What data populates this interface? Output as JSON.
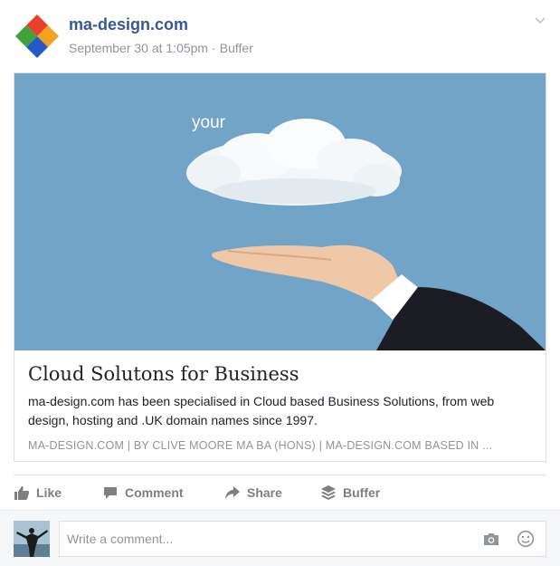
{
  "post": {
    "page_name": "ma-design.com",
    "date": "September 30 at 1:05pm",
    "separator": "·",
    "via": "Buffer"
  },
  "card": {
    "image_word": "your",
    "title": "Cloud Solutons for Business",
    "description": "ma-design.com has been specialised in Cloud based Business Solutions, from web design, hosting and .UK domain names since 1997.",
    "domain_line": "MA-DESIGN.COM | BY CLIVE MOORE MA BA (HONS) | MA-DESIGN.COM BASED IN ..."
  },
  "actions": {
    "like": "Like",
    "comment": "Comment",
    "share": "Share",
    "buffer": "Buffer"
  },
  "comment_box": {
    "placeholder": "Write a comment..."
  },
  "colors": {
    "page_name": "#365899",
    "sky": "#72a4c7",
    "muted": "#90949c",
    "action": "#7f7f7f"
  },
  "icons": [
    "ma-design-logo",
    "chevron-down-icon",
    "like-icon",
    "comment-icon",
    "share-icon",
    "buffer-icon",
    "camera-icon",
    "smiley-icon"
  ]
}
